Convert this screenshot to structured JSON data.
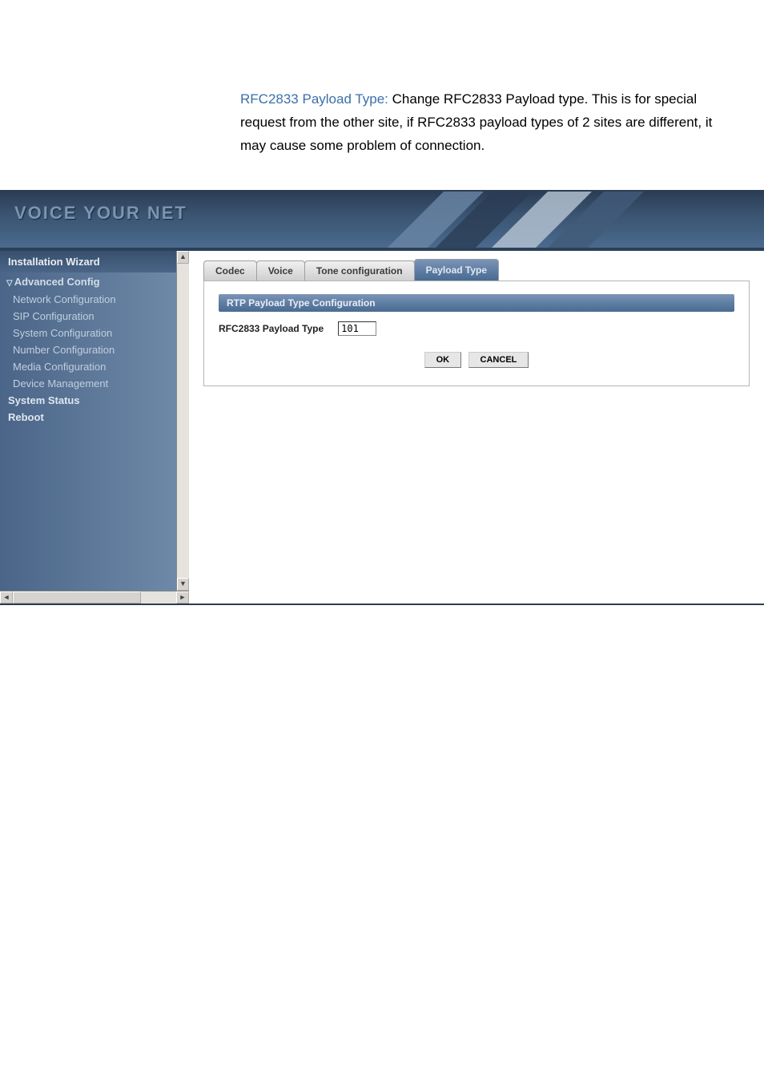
{
  "description": {
    "bluelabel": "RFC2833 Payload Type:",
    "text": " Change RFC2833 Payload type. This is for special request from the other site, if RFC2833 payload types of 2 sites are different, it may cause some problem of connection."
  },
  "banner": {
    "title": "VOICE YOUR NET"
  },
  "sidebar": {
    "install": "Installation Wizard",
    "advgroup": "Advanced Config",
    "items": [
      "Network Configuration",
      "SIP Configuration",
      "System Configuration",
      "Number Configuration",
      "Media Configuration",
      "Device Management"
    ],
    "status": "System Status",
    "reboot": "Reboot"
  },
  "tabs": {
    "codec": "Codec",
    "voice": "Voice",
    "tone": "Tone configuration",
    "payload": "Payload Type"
  },
  "form": {
    "section_title": "RTP Payload Type Configuration",
    "field_label": "RFC2833 Payload Type",
    "field_value": "101",
    "ok": "OK",
    "cancel": "CANCEL"
  }
}
